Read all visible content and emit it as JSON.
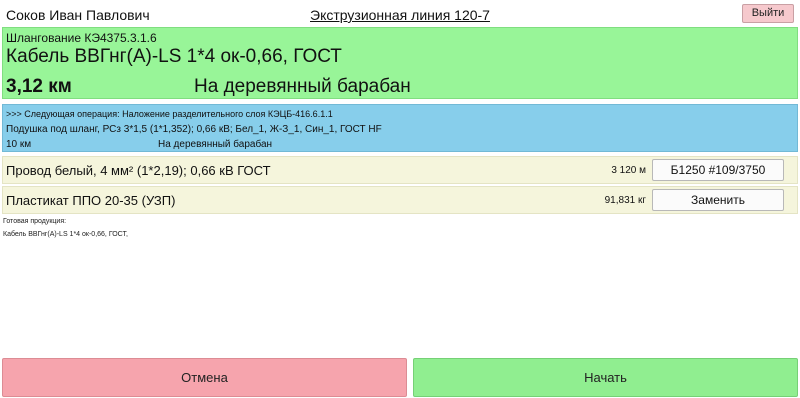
{
  "header": {
    "user_name": "Соков Иван Павлович",
    "line_title": "Экструзионная линия 120-7",
    "logout_label": "Выйти"
  },
  "current_task": {
    "operation": "Шлангование КЭ4375.3.1.6",
    "product": "Кабель ВВГнг(А)-LS 1*4 ок-0,66, ГОСТ",
    "length": "3,12 км",
    "drum": "На деревянный барабан"
  },
  "next_task": {
    "next_operation": ">>> Следующая операция: Наложение разделительного слоя КЭЦБ-416.6.1.1",
    "spec": "Подушка под шланг, РСз 3*1,5 (1*1,352); 0,66 кВ; Бел_1, Ж-З_1, Син_1,  ГОСТ HF",
    "length": "10 км",
    "drum": "На деревянный барабан"
  },
  "materials": [
    {
      "name": "Провод белый, 4 мм² (1*2,19); 0,66 кВ ГОСТ",
      "quantity": "3 120 м",
      "button_label": "Б1250 #109/3750"
    },
    {
      "name": "Пластикат ППО 20-35 (УЗП)",
      "quantity": "91,831 кг",
      "button_label": "Заменить"
    }
  ],
  "finished_product": {
    "label": "Готовая продукция:",
    "value": "Кабель ВВГнг(А)-LS 1*4 ок-0,66, ГОСТ,"
  },
  "actions": {
    "cancel_label": "Отмена",
    "start_label": "Начать"
  },
  "colors": {
    "current_panel": "#98f598",
    "next_panel": "#87ceeb",
    "material_row": "#f5f5dc",
    "cancel": "#f6a4ad",
    "start": "#90ee90",
    "logout": "#f6c9cd"
  }
}
